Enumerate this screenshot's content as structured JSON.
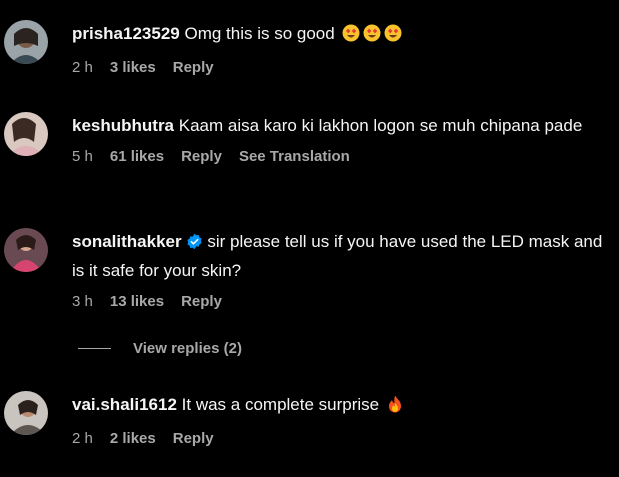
{
  "comments": [
    {
      "username": "prisha123529",
      "text": "Omg this is so good",
      "time": "2 h",
      "likes": "3 likes",
      "reply": "Reply"
    },
    {
      "username": "keshubhutra",
      "text": "Kaam aisa karo ki lakhon logon se muh chipana pade",
      "time": "5 h",
      "likes": "61 likes",
      "reply": "Reply",
      "translate": "See Translation"
    },
    {
      "username": "sonalithakker",
      "verified": true,
      "text": "sir please tell us if you have used the LED mask and is it safe for your skin?",
      "time": "3 h",
      "likes": "13 likes",
      "reply": "Reply",
      "view_replies": "View replies (2)"
    },
    {
      "username": "vai.shali1612",
      "text": "It was a complete surprise",
      "time": "2 h",
      "likes": "2 likes",
      "reply": "Reply"
    }
  ],
  "colors": {
    "background": "#000000",
    "text": "#f5f5f5",
    "meta": "#a8a8a8",
    "verified": "#0095f6"
  },
  "icons": [
    "heart-eyes-emoji",
    "verified-badge-icon",
    "fire-emoji"
  ]
}
